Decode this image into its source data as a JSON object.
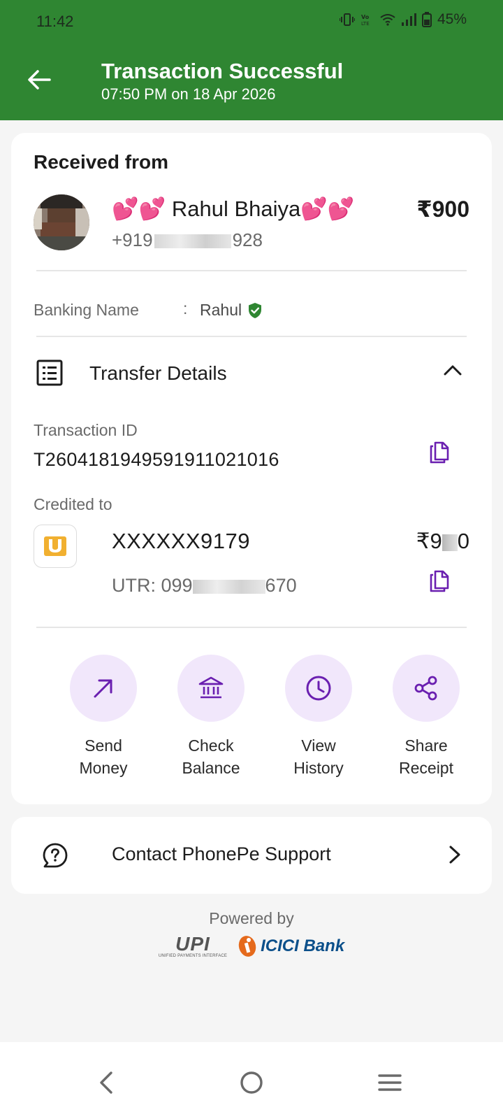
{
  "status_bar": {
    "time": "11:42",
    "battery": "45%"
  },
  "header": {
    "title": "Transaction Successful",
    "subtitle": "07:50 PM on 18 Apr 2026"
  },
  "received": {
    "label": "Received from",
    "name_prefix": "💕💕",
    "name": "Rahul Bhaiya",
    "name_suffix": "💕💕",
    "phone_start": "+919",
    "phone_end": "928",
    "amount": "₹900"
  },
  "banking": {
    "label": "Banking Name",
    "colon": ":",
    "value": "Rahul"
  },
  "transfer": {
    "title": "Transfer Details",
    "txn_label": "Transaction ID",
    "txn_id": "T2604181949591911021016",
    "credited_label": "Credited to",
    "account": "XXXXXX9179",
    "amount_start": "₹9",
    "amount_end": "0",
    "utr_start": "UTR: 099",
    "utr_end": "670"
  },
  "actions": [
    {
      "line1": "Send",
      "line2": "Money",
      "icon": "arrow-up-right-icon"
    },
    {
      "line1": "Check",
      "line2": "Balance",
      "icon": "bank-icon"
    },
    {
      "line1": "View",
      "line2": "History",
      "icon": "clock-icon"
    },
    {
      "line1": "Share",
      "line2": "Receipt",
      "icon": "share-icon"
    }
  ],
  "support": {
    "label": "Contact PhonePe Support"
  },
  "footer": {
    "powered_by": "Powered by",
    "upi": "UPI",
    "upi_sub": "UNIFIED PAYMENTS INTERFACE",
    "bank": "ICICI Bank"
  },
  "colors": {
    "header_green": "#2f8632",
    "accent_purple": "#6a1fb0",
    "action_bg": "#f1e7fb",
    "verified_green": "#2f8632"
  }
}
